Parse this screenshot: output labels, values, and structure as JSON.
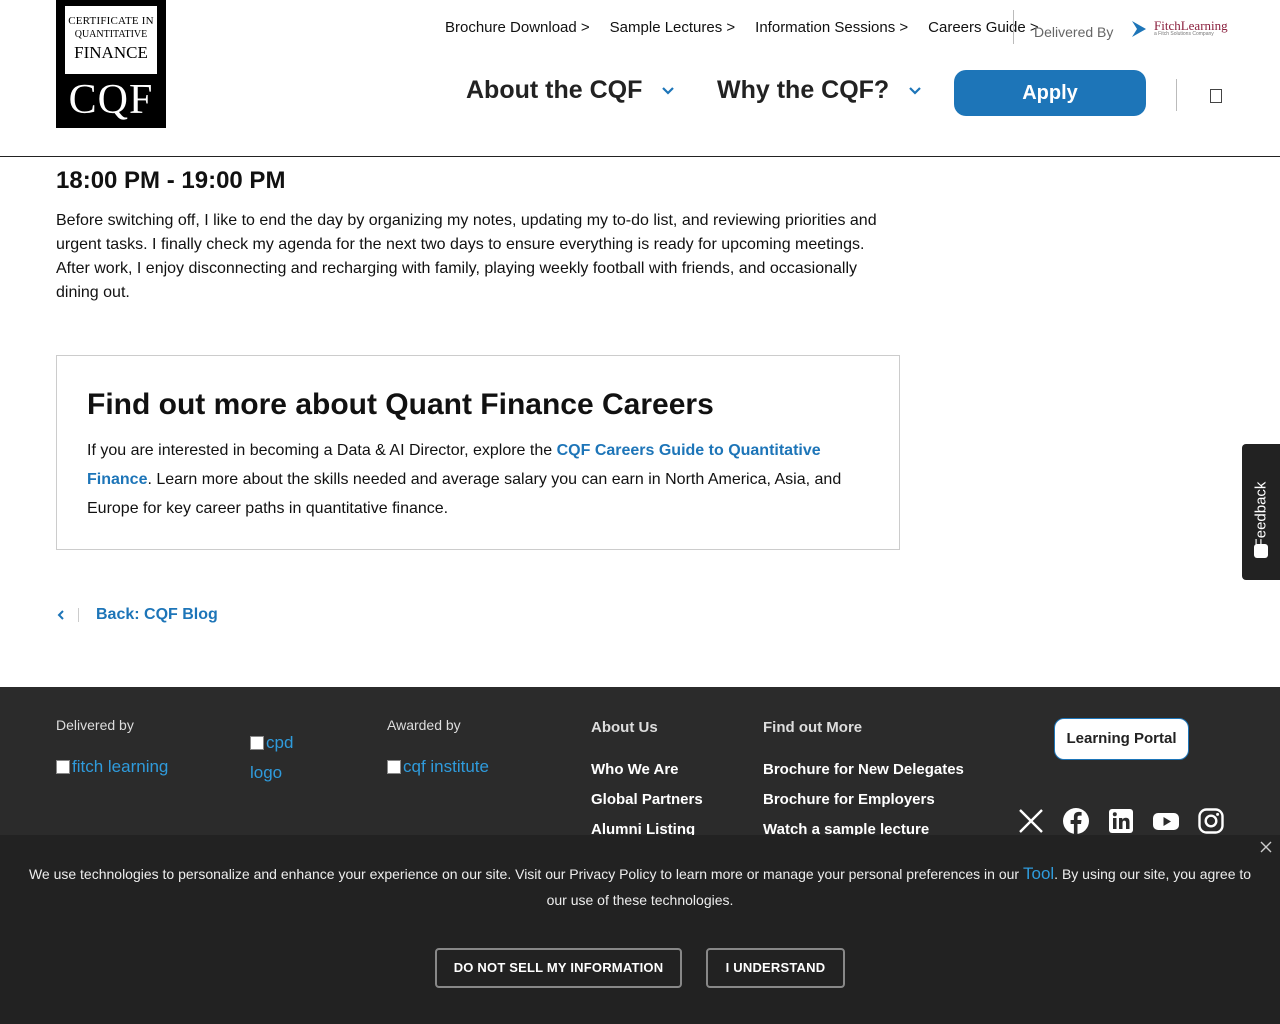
{
  "header": {
    "logo": {
      "line1": "CERTIFICATE IN",
      "line2": "QUANTITATIVE",
      "line3": "FINANCE",
      "mark": "CQF"
    },
    "top_links": [
      "Brochure Download >",
      "Sample Lectures >",
      "Information Sessions >",
      "Careers Guide >"
    ],
    "delivered_by": "Delivered By",
    "fitch_logo": {
      "name": "FitchLearning",
      "sub": "a Fitch Solutions Company"
    },
    "nav": {
      "about": "About the CQF",
      "why": "Why the CQF?",
      "apply": "Apply"
    }
  },
  "article": {
    "time_heading": "18:00 PM - 19:00 PM",
    "paragraph": "Before switching off, I like to end the day by organizing my notes, updating my to-do list, and reviewing priorities and urgent tasks. I finally check my agenda for the next two days to ensure everything is ready for upcoming meetings. After work, I enjoy disconnecting and recharging with family, playing weekly football with friends, and occasionally dining out."
  },
  "careers_card": {
    "title": "Find out more about Quant Finance Careers",
    "text_before": "If you are interested in becoming a Data & AI Director, explore the ",
    "link": "CQF Careers Guide to Quantitative Finance",
    "text_after": ". Learn more about the skills needed and average salary you can earn in North America, Asia, and Europe for key career paths in quantitative finance."
  },
  "back_link": "Back: CQF Blog",
  "feedback": "Feedback",
  "footer": {
    "delivered_by": "Delivered by",
    "fitch_alt": "fitch learning",
    "cpd_alt_1": "cpd",
    "cpd_alt_2": "logo",
    "awarded_by": "Awarded by",
    "cqf_alt": "cqf institute",
    "about_us": {
      "heading": "About Us",
      "links": [
        "Who We Are",
        "Global Partners",
        "Alumni Listing"
      ]
    },
    "find_out_more": {
      "heading": "Find out More",
      "links": [
        "Brochure for New Delegates",
        "Brochure for Employers",
        "Watch a sample lecture"
      ]
    },
    "learning_portal": "Learning Portal",
    "social": [
      "x-icon",
      "facebook-icon",
      "linkedin-icon",
      "youtube-icon",
      "instagram-icon"
    ]
  },
  "cookie_banner": {
    "message_before": "We use technologies to personalize and enhance your experience on our site. Visit our Privacy Policy to learn more or manage your personal preferences in our ",
    "tool_link": "Tool",
    "message_after": ". By using our site, you agree to our use of these technologies.",
    "do_not_sell": "DO NOT SELL MY INFORMATION",
    "understand": "I UNDERSTAND"
  },
  "colors": {
    "accent": "#1d75b8",
    "footer_bg": "#2b2b2b",
    "banner_bg": "#222222"
  }
}
